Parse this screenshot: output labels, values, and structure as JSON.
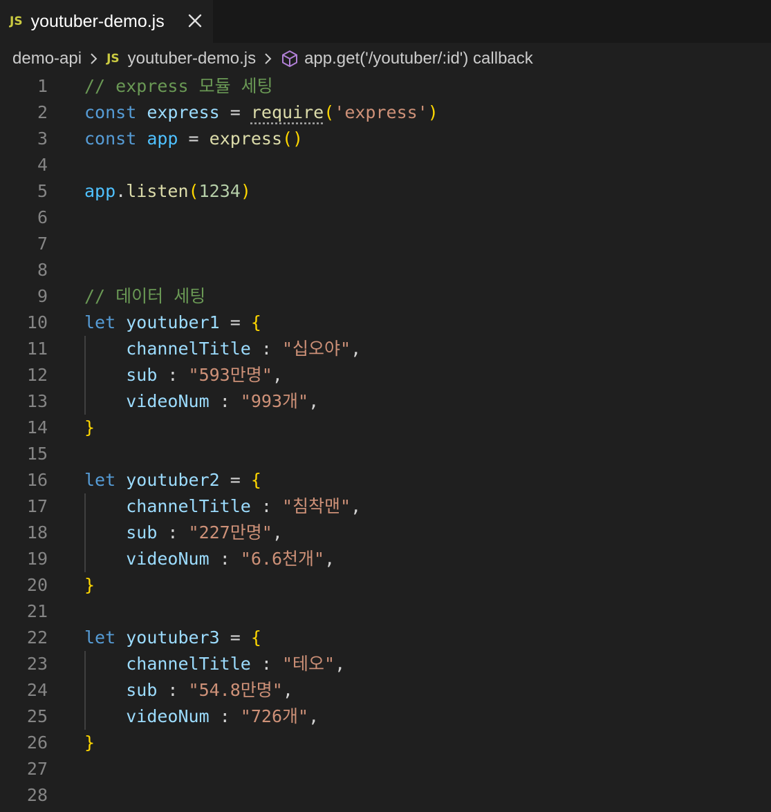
{
  "tab": {
    "badge": "JS",
    "file_name": "youtuber-demo.js",
    "close_icon": "close-icon"
  },
  "breadcrumb": {
    "folder": "demo-api",
    "file_badge": "JS",
    "file": "youtuber-demo.js",
    "symbol_icon": "method-cube-icon",
    "symbol": "app.get('/youtuber/:id') callback"
  },
  "editor": {
    "lines": [
      {
        "n": "1",
        "tokens": [
          {
            "t": "// express 모듈 세팅",
            "c": "comment"
          }
        ]
      },
      {
        "n": "2",
        "tokens": [
          {
            "t": "const",
            "c": "keyword"
          },
          {
            "t": " ",
            "c": "op"
          },
          {
            "t": "express",
            "c": "var"
          },
          {
            "t": " = ",
            "c": "op"
          },
          {
            "t": "require",
            "c": "func",
            "d": true
          },
          {
            "t": "(",
            "c": "brace"
          },
          {
            "t": "'express'",
            "c": "string"
          },
          {
            "t": ")",
            "c": "brace"
          }
        ]
      },
      {
        "n": "3",
        "tokens": [
          {
            "t": "const",
            "c": "keyword"
          },
          {
            "t": " ",
            "c": "op"
          },
          {
            "t": "app",
            "c": "const"
          },
          {
            "t": " = ",
            "c": "op"
          },
          {
            "t": "express",
            "c": "func"
          },
          {
            "t": "()",
            "c": "brace"
          }
        ]
      },
      {
        "n": "4",
        "tokens": []
      },
      {
        "n": "5",
        "tokens": [
          {
            "t": "app",
            "c": "const"
          },
          {
            "t": ".",
            "c": "op"
          },
          {
            "t": "listen",
            "c": "func"
          },
          {
            "t": "(",
            "c": "brace"
          },
          {
            "t": "1234",
            "c": "number"
          },
          {
            "t": ")",
            "c": "brace"
          }
        ]
      },
      {
        "n": "6",
        "tokens": []
      },
      {
        "n": "7",
        "tokens": []
      },
      {
        "n": "8",
        "tokens": []
      },
      {
        "n": "9",
        "tokens": [
          {
            "t": "// 데이터 세팅",
            "c": "comment"
          }
        ]
      },
      {
        "n": "10",
        "tokens": [
          {
            "t": "let",
            "c": "keyword"
          },
          {
            "t": " ",
            "c": "op"
          },
          {
            "t": "youtuber1",
            "c": "var"
          },
          {
            "t": " = ",
            "c": "op"
          },
          {
            "t": "{",
            "c": "brace"
          }
        ]
      },
      {
        "n": "11",
        "tokens": [
          {
            "t": "    ",
            "c": "op"
          },
          {
            "t": "channelTitle",
            "c": "prop"
          },
          {
            "t": " : ",
            "c": "op"
          },
          {
            "t": "\"십오야\"",
            "c": "string"
          },
          {
            "t": ",",
            "c": "op"
          }
        ]
      },
      {
        "n": "12",
        "tokens": [
          {
            "t": "    ",
            "c": "op"
          },
          {
            "t": "sub",
            "c": "prop"
          },
          {
            "t": " : ",
            "c": "op"
          },
          {
            "t": "\"593만명\"",
            "c": "string"
          },
          {
            "t": ",",
            "c": "op"
          }
        ]
      },
      {
        "n": "13",
        "tokens": [
          {
            "t": "    ",
            "c": "op"
          },
          {
            "t": "videoNum",
            "c": "prop"
          },
          {
            "t": " : ",
            "c": "op"
          },
          {
            "t": "\"993개\"",
            "c": "string"
          },
          {
            "t": ",",
            "c": "op"
          }
        ]
      },
      {
        "n": "14",
        "tokens": [
          {
            "t": "}",
            "c": "brace"
          }
        ]
      },
      {
        "n": "15",
        "tokens": []
      },
      {
        "n": "16",
        "tokens": [
          {
            "t": "let",
            "c": "keyword"
          },
          {
            "t": " ",
            "c": "op"
          },
          {
            "t": "youtuber2",
            "c": "var"
          },
          {
            "t": " = ",
            "c": "op"
          },
          {
            "t": "{",
            "c": "brace"
          }
        ]
      },
      {
        "n": "17",
        "tokens": [
          {
            "t": "    ",
            "c": "op"
          },
          {
            "t": "channelTitle",
            "c": "prop"
          },
          {
            "t": " : ",
            "c": "op"
          },
          {
            "t": "\"침착맨\"",
            "c": "string"
          },
          {
            "t": ",",
            "c": "op"
          }
        ]
      },
      {
        "n": "18",
        "tokens": [
          {
            "t": "    ",
            "c": "op"
          },
          {
            "t": "sub",
            "c": "prop"
          },
          {
            "t": " : ",
            "c": "op"
          },
          {
            "t": "\"227만명\"",
            "c": "string"
          },
          {
            "t": ",",
            "c": "op"
          }
        ]
      },
      {
        "n": "19",
        "tokens": [
          {
            "t": "    ",
            "c": "op"
          },
          {
            "t": "videoNum",
            "c": "prop"
          },
          {
            "t": " : ",
            "c": "op"
          },
          {
            "t": "\"6.6천개\"",
            "c": "string"
          },
          {
            "t": ",",
            "c": "op"
          }
        ]
      },
      {
        "n": "20",
        "tokens": [
          {
            "t": "}",
            "c": "brace"
          }
        ]
      },
      {
        "n": "21",
        "tokens": []
      },
      {
        "n": "22",
        "tokens": [
          {
            "t": "let",
            "c": "keyword"
          },
          {
            "t": " ",
            "c": "op"
          },
          {
            "t": "youtuber3",
            "c": "var"
          },
          {
            "t": " = ",
            "c": "op"
          },
          {
            "t": "{",
            "c": "brace"
          }
        ]
      },
      {
        "n": "23",
        "tokens": [
          {
            "t": "    ",
            "c": "op"
          },
          {
            "t": "channelTitle",
            "c": "prop"
          },
          {
            "t": " : ",
            "c": "op"
          },
          {
            "t": "\"테오\"",
            "c": "string"
          },
          {
            "t": ",",
            "c": "op"
          }
        ]
      },
      {
        "n": "24",
        "tokens": [
          {
            "t": "    ",
            "c": "op"
          },
          {
            "t": "sub",
            "c": "prop"
          },
          {
            "t": " : ",
            "c": "op"
          },
          {
            "t": "\"54.8만명\"",
            "c": "string"
          },
          {
            "t": ",",
            "c": "op"
          }
        ]
      },
      {
        "n": "25",
        "tokens": [
          {
            "t": "    ",
            "c": "op"
          },
          {
            "t": "videoNum",
            "c": "prop"
          },
          {
            "t": " : ",
            "c": "op"
          },
          {
            "t": "\"726개\"",
            "c": "string"
          },
          {
            "t": ",",
            "c": "op"
          }
        ]
      },
      {
        "n": "26",
        "tokens": [
          {
            "t": "}",
            "c": "brace"
          }
        ]
      },
      {
        "n": "27",
        "tokens": []
      },
      {
        "n": "28",
        "tokens": []
      }
    ]
  }
}
